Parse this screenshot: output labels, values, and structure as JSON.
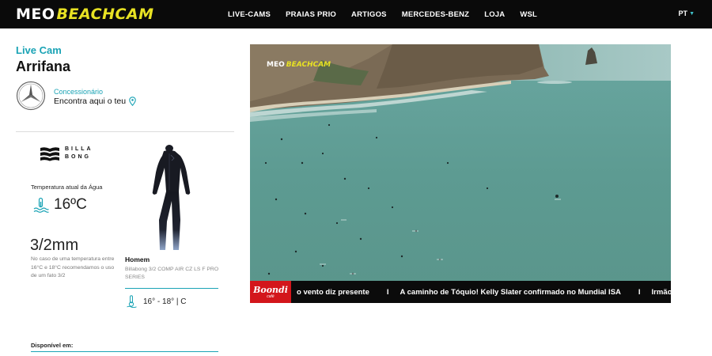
{
  "header": {
    "logo_meo": "MEO",
    "logo_beachcam": "BEACHCAM",
    "nav": [
      "LIVE-CAMS",
      "PRAIAS PRIO",
      "ARTIGOS",
      "MERCEDES-BENZ",
      "LOJA",
      "WSL"
    ],
    "language": "PT"
  },
  "spot": {
    "live_label": "Live Cam",
    "name": "Arrifana"
  },
  "dealer": {
    "label": "Concessionário",
    "link": "Encontra aqui o teu"
  },
  "billabong": {
    "text_line1": "BILLA",
    "text_line2": "BONG"
  },
  "water": {
    "label": "Temperatura atual da Água",
    "temperature": "16ºC"
  },
  "suit": {
    "thickness": "3/2mm",
    "advice": "No caso de uma temperatura entre 16°C e 18°C recomendamos o uso de um fato 3/2",
    "gender": "Homem",
    "model": "Billabong 3/2 COMP AIR CZ LS F PRO SERIES",
    "range": "16° - 18° | C"
  },
  "availability": {
    "label": "Disponível em:"
  },
  "camera": {
    "overlay_meo": "MEO",
    "overlay_beachcam": "BEACHCAM"
  },
  "ticker": {
    "sponsor_name": "Boondi",
    "sponsor_sub": "café",
    "items": [
      "o vento diz presente",
      "A caminho de Tóquio! Kelly Slater confirmado no Mundial ISA",
      "Irmão de Jol"
    ],
    "separator": "I"
  },
  "colors": {
    "accent": "#1aa3b5",
    "brand_yellow": "#e8e223",
    "topbar": "#0a0a0a",
    "ticker_sponsor": "#d3161b"
  },
  "icons": {
    "dealer_pin": "map-pin-icon",
    "water": "water-temperature-icon",
    "range": "thermometer-icon",
    "brand": "mercedes-benz-icon",
    "language_chevron": "chevron-down-icon"
  }
}
